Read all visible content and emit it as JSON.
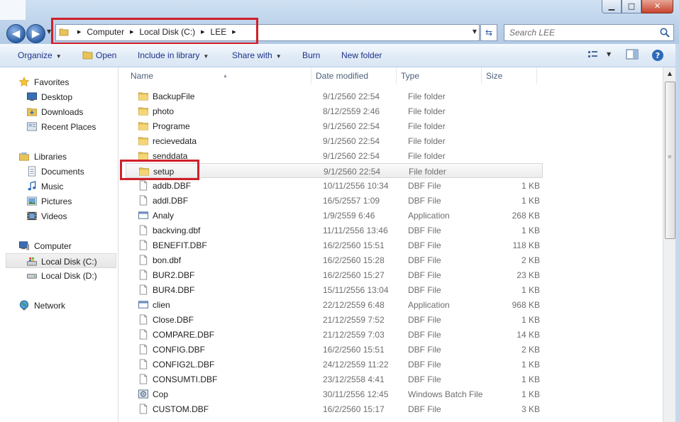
{
  "window": {
    "min_label": "▁",
    "max_label": "□",
    "close_label": "✕"
  },
  "address": {
    "crumbs": [
      "Computer",
      "Local Disk (C:)",
      "LEE"
    ]
  },
  "search": {
    "placeholder": "Search LEE"
  },
  "toolbar": {
    "organize": "Organize",
    "open": "Open",
    "include": "Include in library",
    "share": "Share with",
    "burn": "Burn",
    "new_folder": "New folder"
  },
  "nav": {
    "favorites": "Favorites",
    "desktop": "Desktop",
    "downloads": "Downloads",
    "recent": "Recent Places",
    "libraries": "Libraries",
    "documents": "Documents",
    "music": "Music",
    "pictures": "Pictures",
    "videos": "Videos",
    "computer": "Computer",
    "local_c": "Local Disk (C:)",
    "local_d": "Local Disk (D:)",
    "network": "Network"
  },
  "columns": {
    "name": "Name",
    "date": "Date modified",
    "type": "Type",
    "size": "Size"
  },
  "files": [
    {
      "name": "BackupFile",
      "date": "9/1/2560 22:54",
      "type": "File folder",
      "size": "",
      "icon": "folder"
    },
    {
      "name": "photo",
      "date": "8/12/2559 2:46",
      "type": "File folder",
      "size": "",
      "icon": "folder"
    },
    {
      "name": "Programe",
      "date": "9/1/2560 22:54",
      "type": "File folder",
      "size": "",
      "icon": "folder"
    },
    {
      "name": "recievedata",
      "date": "9/1/2560 22:54",
      "type": "File folder",
      "size": "",
      "icon": "folder"
    },
    {
      "name": "senddata",
      "date": "9/1/2560 22:54",
      "type": "File folder",
      "size": "",
      "icon": "folder"
    },
    {
      "name": "setup",
      "date": "9/1/2560 22:54",
      "type": "File folder",
      "size": "",
      "icon": "folder"
    },
    {
      "name": "addb.DBF",
      "date": "10/11/2556 10:34",
      "type": "DBF File",
      "size": "1 KB",
      "icon": "file"
    },
    {
      "name": "addl.DBF",
      "date": "16/5/2557 1:09",
      "type": "DBF File",
      "size": "1 KB",
      "icon": "file"
    },
    {
      "name": "Analy",
      "date": "1/9/2559 6:46",
      "type": "Application",
      "size": "268 KB",
      "icon": "app"
    },
    {
      "name": "backving.dbf",
      "date": "11/11/2556 13:46",
      "type": "DBF File",
      "size": "1 KB",
      "icon": "file"
    },
    {
      "name": "BENEFIT.DBF",
      "date": "16/2/2560 15:51",
      "type": "DBF File",
      "size": "118 KB",
      "icon": "file"
    },
    {
      "name": "bon.dbf",
      "date": "16/2/2560 15:28",
      "type": "DBF File",
      "size": "2 KB",
      "icon": "file"
    },
    {
      "name": "BUR2.DBF",
      "date": "16/2/2560 15:27",
      "type": "DBF File",
      "size": "23 KB",
      "icon": "file"
    },
    {
      "name": "BUR4.DBF",
      "date": "15/11/2556 13:04",
      "type": "DBF File",
      "size": "1 KB",
      "icon": "file"
    },
    {
      "name": "clien",
      "date": "22/12/2559 6:48",
      "type": "Application",
      "size": "968 KB",
      "icon": "app"
    },
    {
      "name": "Close.DBF",
      "date": "21/12/2559 7:52",
      "type": "DBF File",
      "size": "1 KB",
      "icon": "file"
    },
    {
      "name": "COMPARE.DBF",
      "date": "21/12/2559 7:03",
      "type": "DBF File",
      "size": "14 KB",
      "icon": "file"
    },
    {
      "name": "CONFIG.DBF",
      "date": "16/2/2560 15:51",
      "type": "DBF File",
      "size": "2 KB",
      "icon": "file"
    },
    {
      "name": "CONFIG2L.DBF",
      "date": "24/12/2559 11:22",
      "type": "DBF File",
      "size": "1 KB",
      "icon": "file"
    },
    {
      "name": "CONSUMTI.DBF",
      "date": "23/12/2558 4:41",
      "type": "DBF File",
      "size": "1 KB",
      "icon": "file"
    },
    {
      "name": "Cop",
      "date": "30/11/2556 12:45",
      "type": "Windows Batch File",
      "size": "1 KB",
      "icon": "batch"
    },
    {
      "name": "CUSTOM.DBF",
      "date": "16/2/2560 15:17",
      "type": "DBF File",
      "size": "3 KB",
      "icon": "file"
    }
  ],
  "selected_file": "setup",
  "colors": {
    "highlight_red": "#d0202a",
    "link_blue": "#1e3287"
  }
}
